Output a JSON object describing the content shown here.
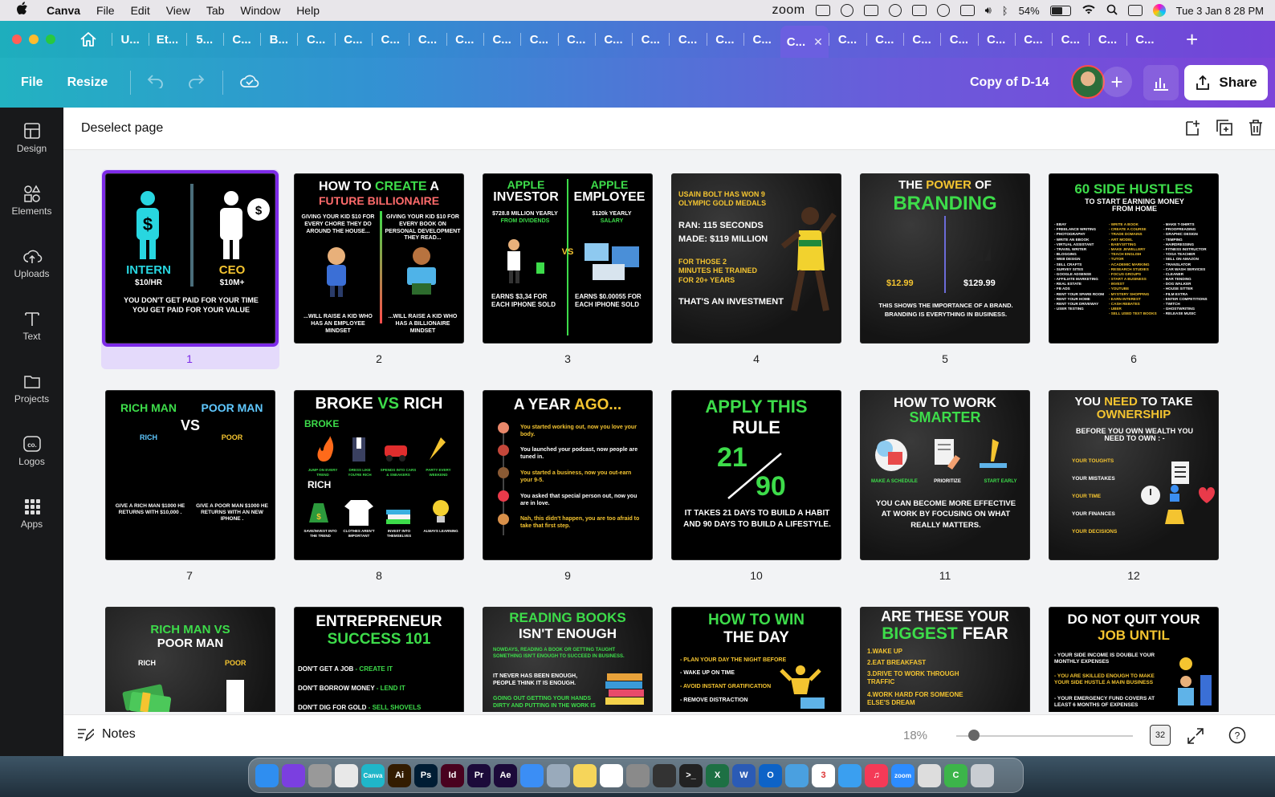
{
  "menubar": {
    "app": "Canva",
    "items": [
      "File",
      "Edit",
      "View",
      "Tab",
      "Window",
      "Help"
    ],
    "zoom_label": "zoom",
    "battery": "54%",
    "datetime": "Tue 3 Jan  8 28 PM"
  },
  "tabs": {
    "items": [
      "U...",
      "Et...",
      "5...",
      "C...",
      "B...",
      "C...",
      "C...",
      "C...",
      "C...",
      "C...",
      "C...",
      "C...",
      "C...",
      "C...",
      "C...",
      "C...",
      "C...",
      "C...",
      "C...",
      "C...",
      "C...",
      "C...",
      "C...",
      "C...",
      "C...",
      "C...",
      "C...",
      "C..."
    ],
    "active_index": 18,
    "close": "✕",
    "new_tab": "+"
  },
  "toolbar": {
    "file": "File",
    "resize": "Resize",
    "doc_title": "Copy of D-14",
    "share": "Share",
    "plus": "+"
  },
  "rail": [
    {
      "label": "Design",
      "icon": "design-icon"
    },
    {
      "label": "Elements",
      "icon": "elements-icon"
    },
    {
      "label": "Uploads",
      "icon": "uploads-icon"
    },
    {
      "label": "Text",
      "icon": "text-icon"
    },
    {
      "label": "Projects",
      "icon": "projects-icon"
    },
    {
      "label": "Logos",
      "icon": "logos-icon"
    },
    {
      "label": "Apps",
      "icon": "apps-icon"
    }
  ],
  "pagebar": {
    "deselect": "Deselect page"
  },
  "pages": {
    "numbers": [
      "1",
      "2",
      "3",
      "4",
      "5",
      "6",
      "7",
      "8",
      "9",
      "10",
      "11",
      "12"
    ],
    "selected": "1",
    "p1": {
      "left_title": "INTERN",
      "left_sub": "$10/HR",
      "right_title": "CEO",
      "right_sub": "$10M+",
      "caption": "YOU DON'T GET PAID FOR YOUR TIME YOU GET PAID FOR YOUR VALUE"
    },
    "p2": {
      "t1": "HOW TO ",
      "t1g": "CREATE",
      "t1b": " A",
      "t2": "FUTURE BILLIONAIRE",
      "l": "GIVING YOUR KID $10 FOR EVERY CHORE THEY DO AROUND THE HOUSE...",
      "r": "GIVING YOUR KID $10 FOR EVERY BOOK ON PERSONAL DEVELOPMENT THEY READ...",
      "lb": "...WILL RAISE A KID WHO HAS AN EMPLOYEE MINDSET",
      "rb": "...WILL RAISE A KID WHO HAS A BILLIONAIRE MINDSET"
    },
    "p3": {
      "l1": "APPLE",
      "l2": "INVESTOR",
      "r1": "APPLE",
      "r2": "EMPLOYEE",
      "ls": "$728.8 MILLION YEARLY",
      "lsg": "FROM DIVIDENDS",
      "rs": "$120k YEARLY",
      "rsg": "SALARY",
      "vs": "VS",
      "le": "EARNS $3,34 FOR EACH IPHONE SOLD",
      "re": "EARNS $0.00055 FOR EACH IPHONE SOLD"
    },
    "p4": {
      "a": "USAIN BOLT HAS WON 9 OLYMPIC GOLD MEDALS",
      "b": "RAN: 115 SECONDS",
      "c": "MADE: $119 MILLION",
      "d": "FOR THOSE 2 MINUTES HE TRAINED FOR 20+ YEARS",
      "e": "THAT'S AN INVESTMENT"
    },
    "p5": {
      "t1": "THE ",
      "t1y": "POWER",
      "t1b": " OF",
      "t2": "BRANDING",
      "p1": "$12.99",
      "p2": "$129.99",
      "cap": "THIS SHOWS THE IMPORTANCE OF A BRAND. BRANDING IS EVERYTHING IN BUSINESS."
    },
    "p6": {
      "t1": "60 SIDE HUSTLES",
      "t2": "TO START EARNING MONEY FROM HOME",
      "c1": "- EBAY\n- FREELANCE WRITING\n- PHOTOGRAPHY\n- WRITE AN EBOOK\n- VIRTUAL ASSISTANT\n- TRAVEL WRITER\n- BLOGGING\n- WEB DESIGN\n- SELL CRAFTS\n- SURVEY SITES\n- GOOGLE ADSENSE\n- AFFILIATE MARKETING\n- REAL ESTATE\n- FB ADS\n- RENT YOUR SPARE ROOM\n- RENT YOUR HOME\n- RENT YOUR DRIVEWAY\n- USER TESTING",
      "c2": "- WRITE A BOOK\n- CREATE A COURSE\n- TRADE DOMAINS\n- ART MODEL\n- BABYSITTING\n- MAKE JEWELLERY\n- TEACH ENGLISH\n- TUTOR\n- ACADEMIC MARKING\n- RESEARCH STUDIES\n- FOCUS GROUPS\n- START A BUSINESS\n- INVEST\n- YOUTUBE\n- MYSTERY SHOPPING\n- EARN INTEREST\n- CASH REBATES\n- UBER\n- SELL USED TEXT BOOKS",
      "c3": "- MAKE T-SHIRTS\n- PROOFREADING\n- GRAPHIC DESIGN\n- TEMPING\n- HAIRDRESSING\n- FITNESS INSTRUCTOR\n- YOGA TEACHER\n- SELL ON AMAZON\n- TRANSLATOR\n- CAR WASH SERVICES\n- CLEANER\n- BAR TENDING\n- DOG WALKER\n- HOUSE SITTER\n- FILM EXTRA\n- ENTER COMPETITIONS\n- TWITCH\n- GHOSTWRITING\n- RELEASE MUSIC"
    },
    "p7": {
      "l": "RICH MAN",
      "r": "POOR MAN",
      "vs": "VS",
      "ls": "RICH",
      "rs": "POOR",
      "lb": "GIVE A RICH MAN $1000 HE RETURNS WITH $10,000 .",
      "rb": "GIVE A POOR MAN $1000 HE RETURNS WITH AN NEW IPHONE ."
    },
    "p8": {
      "t1": "BROKE ",
      "t1g": "VS",
      "t1b": " RICH",
      "broke": "BROKE",
      "rich": "RICH",
      "a": "JUMP ON EVERY TREND",
      "b": "DRESS LIKE YOU'RE RICH",
      "c": "SPENDS INTO CARS & SNEAKERS",
      "d": "PARTY EVERY WEEKEND",
      "e": "SAVE/INVEST INTO THE TREND",
      "f": "CLOTHES AREN'T IMPORTANT",
      "g": "INVEST INTO THEMSELVES",
      "h": "ALWAYS LEARNING"
    },
    "p9": {
      "t1": "A YEAR ",
      "t1y": "AGO...",
      "a": "You started working out, now you love your body.",
      "b": "You launched your podcast, now people are tuned in.",
      "c": "You started a business, now you out-earn your 9-5.",
      "d": "You asked that special person out, now you are in love.",
      "e": "Nah, this didn't happen, you are too afraid to take that first step."
    },
    "p10": {
      "t1": "APPLY THIS",
      "t2": "RULE",
      "n1": "21",
      "n2": "90",
      "cap": "IT TAKES 21 DAYS TO BUILD A HABIT AND 90 DAYS TO BUILD A LIFESTYLE."
    },
    "p11": {
      "t1": "HOW TO WORK",
      "t2": "SMARTER",
      "a": "MAKE A SCHEDULE",
      "b": "PRIORITIZE",
      "c": "START EARLY",
      "cap": "YOU CAN BECOME MORE EFFECTIVE AT WORK BY FOCUSING ON WHAT REALLY MATTERS."
    },
    "p12": {
      "t1": "YOU ",
      "t1y": "NEED",
      "t1b": " TO TAKE",
      "t2": "OWNERSHIP",
      "sub": "BEFORE YOU OWN WEALTH YOU NEED TO OWN : -",
      "a": "YOUR TOUGHTS",
      "b": "YOUR MISTAKES",
      "c": "YOUR TIME",
      "d": "YOUR FINANCES",
      "e": "YOUR DECISIONS"
    },
    "p13": {
      "t1": "RICH MAN VS",
      "t2": "POOR MAN",
      "l": "RICH",
      "r": "POOR"
    },
    "p14": {
      "t1": "ENTREPRENEUR",
      "t2": "SUCCESS 101",
      "a": "DON'T GET A JOB",
      "ag": " - CREATE IT",
      "b": "DON'T BORROW MONEY",
      "bg": " - LEND IT",
      "c": "DON'T DIG FOR GOLD",
      "cg": "  - SELL SHOVELS"
    },
    "p15": {
      "t1": "READING BOOKS",
      "t2": "ISN'T ENOUGH",
      "a": "NOWDAYS, READING A BOOK OR GETTING TAUGHT SOMETHING ISN'T ENOUGH TO SUCCEED IN BUSINESS.",
      "b": "IT NEVER HAS BEEN ENOUGH, PEOPLE THINK IT IS ENOUGH.",
      "c": "GOING OUT GETTING YOUR HANDS DIRTY AND PUTTING IN THE WORK IS"
    },
    "p16": {
      "t1": "HOW TO WIN",
      "t2": "THE DAY",
      "a": "- PLAN YOUR DAY THE NIGHT BEFORE",
      "b": "- WAKE UP ON TIME",
      "c": "- AVOID INSTANT GRATIFICATION",
      "d": "- REMOVE DISTRACTION"
    },
    "p17": {
      "t1": "ARE THESE YOUR",
      "t2": "BIGGEST",
      "t2b": " FEAR",
      "a": "1.WAKE UP",
      "b": "2.EAT BREAKFAST",
      "c": "3.DRIVE TO WORK THROUGH TRAFFIC",
      "d": "4.WORK HARD FOR SOMEONE ELSE'S DREAM"
    },
    "p18": {
      "t1": "DO NOT QUIT YOUR",
      "t2": "JOB UNTIL",
      "a": "- YOUR SIDE INCOME IS DOUBLE YOUR MONTHLY EXPENSES",
      "b": "- YOU ARE SKILLED ENOUGH TO MAKE YOUR SIDE HUSTLE A MAIN BUSINESS",
      "c": "- YOUR EMERGENCY FUND COVERS AT LEAST 6 MONTHS OF EXPENSES"
    }
  },
  "bottombar": {
    "notes": "Notes",
    "zoom": "18%",
    "page_count": "32",
    "help": "?"
  },
  "dock": {
    "apps": [
      {
        "name": "finder",
        "color": "#2f8ef0",
        "label": ""
      },
      {
        "name": "siri",
        "color": "#7b3fe0",
        "label": ""
      },
      {
        "name": "launchpad",
        "color": "#999",
        "label": ""
      },
      {
        "name": "chrome",
        "color": "#e8e8e8",
        "label": ""
      },
      {
        "name": "canva",
        "color": "#1fb6c9",
        "label": "Canva"
      },
      {
        "name": "illustrator",
        "color": "#331c00",
        "label": "Ai"
      },
      {
        "name": "photoshop",
        "color": "#001d34",
        "label": "Ps"
      },
      {
        "name": "indesign",
        "color": "#49021f",
        "label": "Id"
      },
      {
        "name": "premiere",
        "color": "#1c0a3a",
        "label": "Pr"
      },
      {
        "name": "after-effects",
        "color": "#1c0a3a",
        "label": "Ae"
      },
      {
        "name": "mail",
        "color": "#3b8ef5",
        "label": ""
      },
      {
        "name": "preview",
        "color": "#9ab",
        "label": ""
      },
      {
        "name": "notes",
        "color": "#f6d55a",
        "label": ""
      },
      {
        "name": "reminders",
        "color": "#fff",
        "label": ""
      },
      {
        "name": "system-preferences",
        "color": "#8a8a8a",
        "label": ""
      },
      {
        "name": "screen-recorder",
        "color": "#333",
        "label": ""
      },
      {
        "name": "terminal",
        "color": "#222",
        "label": ">_"
      },
      {
        "name": "excel",
        "color": "#1d7044",
        "label": "X"
      },
      {
        "name": "word",
        "color": "#2b5bb5",
        "label": "W"
      },
      {
        "name": "outlook",
        "color": "#0d63c7",
        "label": "O"
      },
      {
        "name": "migration",
        "color": "#4aa0e0",
        "label": ""
      },
      {
        "name": "calendar",
        "color": "#fff",
        "label": "3"
      },
      {
        "name": "safari",
        "color": "#3a9ff0",
        "label": ""
      },
      {
        "name": "music",
        "color": "#f43a57",
        "label": "♫"
      },
      {
        "name": "zoom",
        "color": "#2d8cff",
        "label": "zoom"
      },
      {
        "name": "quicktime",
        "color": "#ddd",
        "label": ""
      },
      {
        "name": "camtasia",
        "color": "#3cb54a",
        "label": "C"
      },
      {
        "name": "trash",
        "color": "#c9cdd2",
        "label": ""
      }
    ]
  }
}
